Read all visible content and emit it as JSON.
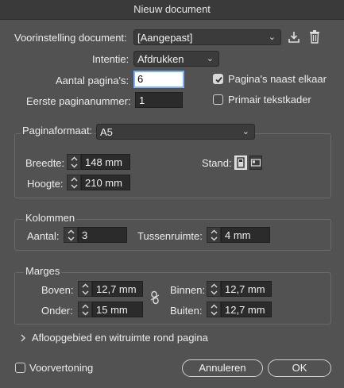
{
  "window": {
    "title": "Nieuw document"
  },
  "preset": {
    "label": "Voorinstelling document:",
    "value": "[Aangepast]",
    "save_icon": "save-preset-icon",
    "delete_icon": "trash-icon"
  },
  "intent": {
    "label": "Intentie:",
    "value": "Afdrukken"
  },
  "pages": {
    "count_label": "Aantal pagina's:",
    "count_value": "6",
    "start_label": "Eerste paginanummer:",
    "start_value": "1",
    "facing_label": "Pagina's naast elkaar",
    "facing_checked": true,
    "primary_label": "Primair tekstkader",
    "primary_checked": false
  },
  "page_size": {
    "label": "Paginaformaat:",
    "value": "A5",
    "width_label": "Breedte:",
    "width_value": "148 mm",
    "height_label": "Hoogte:",
    "height_value": "210 mm",
    "orientation_label": "Stand:",
    "orientation_selected": "portrait"
  },
  "columns": {
    "title": "Kolommen",
    "count_label": "Aantal:",
    "count_value": "3",
    "gutter_label": "Tussenruimte:",
    "gutter_value": "4 mm"
  },
  "margins": {
    "title": "Marges",
    "top_label": "Boven:",
    "top_value": "12,7 mm",
    "bottom_label": "Onder:",
    "bottom_value": "15 mm",
    "inside_label": "Binnen:",
    "inside_value": "12,7 mm",
    "outside_label": "Buiten:",
    "outside_value": "12,7 mm",
    "link_icon": "unlinked-chain-icon"
  },
  "bleed": {
    "label": "Afloopgebied en witruimte rond pagina"
  },
  "footer": {
    "preview_label": "Voorvertoning",
    "preview_checked": false,
    "cancel_label": "Annuleren",
    "ok_label": "OK"
  },
  "colors": {
    "background": "#525252",
    "titlebar": "#3a3a3a",
    "focus": "#7ab0ff"
  }
}
